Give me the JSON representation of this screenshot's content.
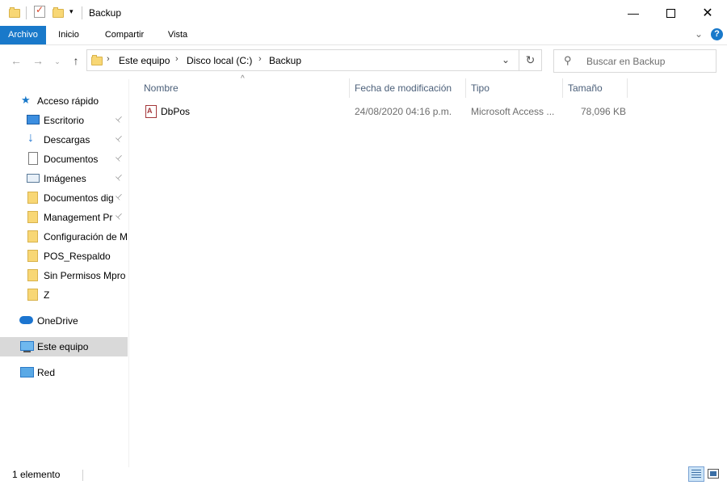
{
  "window": {
    "title": "Backup",
    "minimize_icon": "minimize-icon",
    "maximize_icon": "maximize-icon",
    "close_icon": "close-icon"
  },
  "ribbon": {
    "tabs": [
      {
        "label": "Archivo",
        "active": true
      },
      {
        "label": "Inicio",
        "active": false
      },
      {
        "label": "Compartir",
        "active": false
      },
      {
        "label": "Vista",
        "active": false
      }
    ],
    "help_icon": "?"
  },
  "address": {
    "crumbs": [
      "Este equipo",
      "Disco local (C:)",
      "Backup"
    ]
  },
  "search": {
    "placeholder": "Buscar en Backup"
  },
  "nav": {
    "quick_access": "Acceso rápido",
    "items": [
      {
        "label": "Escritorio",
        "pinned": true,
        "icon": "desktop-icon"
      },
      {
        "label": "Descargas",
        "pinned": true,
        "icon": "download-icon"
      },
      {
        "label": "Documentos",
        "pinned": true,
        "icon": "document-icon"
      },
      {
        "label": "Imágenes",
        "pinned": true,
        "icon": "pictures-icon"
      },
      {
        "label": "Documentos dig",
        "pinned": true,
        "icon": "folder-icon"
      },
      {
        "label": "Management Pr",
        "pinned": true,
        "icon": "folder-icon"
      },
      {
        "label": "Configuración de M",
        "pinned": false,
        "icon": "folder-icon"
      },
      {
        "label": "POS_Respaldo",
        "pinned": false,
        "icon": "folder-icon"
      },
      {
        "label": "Sin Permisos Mpro",
        "pinned": false,
        "icon": "folder-icon"
      },
      {
        "label": "Z",
        "pinned": false,
        "icon": "folder-icon"
      }
    ],
    "onedrive": "OneDrive",
    "this_pc": "Este equipo",
    "network": "Red"
  },
  "columns": {
    "name": "Nombre",
    "modified": "Fecha de modificación",
    "type": "Tipo",
    "size": "Tamaño"
  },
  "files": [
    {
      "name": "DbPos",
      "modified": "24/08/2020 04:16 p.m.",
      "type": "Microsoft Access ...",
      "size": "78,096 KB"
    }
  ],
  "status": {
    "count": "1 elemento"
  },
  "colors": {
    "accent": "#1979ca",
    "selected_bg": "#d9d9d9",
    "header_text": "#4c607a"
  }
}
